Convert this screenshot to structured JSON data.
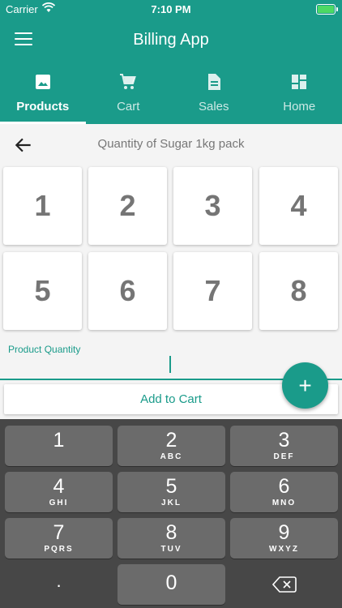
{
  "status_bar": {
    "carrier": "Carrier",
    "time": "7:10 PM"
  },
  "app_bar": {
    "title": "Billing App",
    "menu_icon": "hamburger-menu-icon"
  },
  "tabs": [
    {
      "label": "Products",
      "icon": "image-icon",
      "active": true
    },
    {
      "label": "Cart",
      "icon": "cart-icon",
      "active": false
    },
    {
      "label": "Sales",
      "icon": "document-icon",
      "active": false
    },
    {
      "label": "Home",
      "icon": "dashboard-icon",
      "active": false
    }
  ],
  "quantity_screen": {
    "title": "Quantity of Sugar 1kg pack",
    "back_icon": "arrow-left-icon",
    "numbers": [
      "1",
      "2",
      "3",
      "4",
      "5",
      "6",
      "7",
      "8"
    ],
    "input_label": "Product Quantity",
    "input_value": "",
    "fab_label": "+",
    "add_to_cart_label": "Add to Cart"
  },
  "keyboard": {
    "keys": [
      {
        "num": "1",
        "letters": ""
      },
      {
        "num": "2",
        "letters": "ABC"
      },
      {
        "num": "3",
        "letters": "DEF"
      },
      {
        "num": "4",
        "letters": "GHI"
      },
      {
        "num": "5",
        "letters": "JKL"
      },
      {
        "num": "6",
        "letters": "MNO"
      },
      {
        "num": "7",
        "letters": "PQRS"
      },
      {
        "num": "8",
        "letters": "TUV"
      },
      {
        "num": "9",
        "letters": "WXYZ"
      },
      {
        "num": ".",
        "letters": ""
      },
      {
        "num": "0",
        "letters": ""
      }
    ],
    "backspace_icon": "backspace-icon"
  },
  "colors": {
    "primary": "#1a9b8a",
    "keyboard_bg": "#474747",
    "key_bg": "#6b6b6b"
  }
}
